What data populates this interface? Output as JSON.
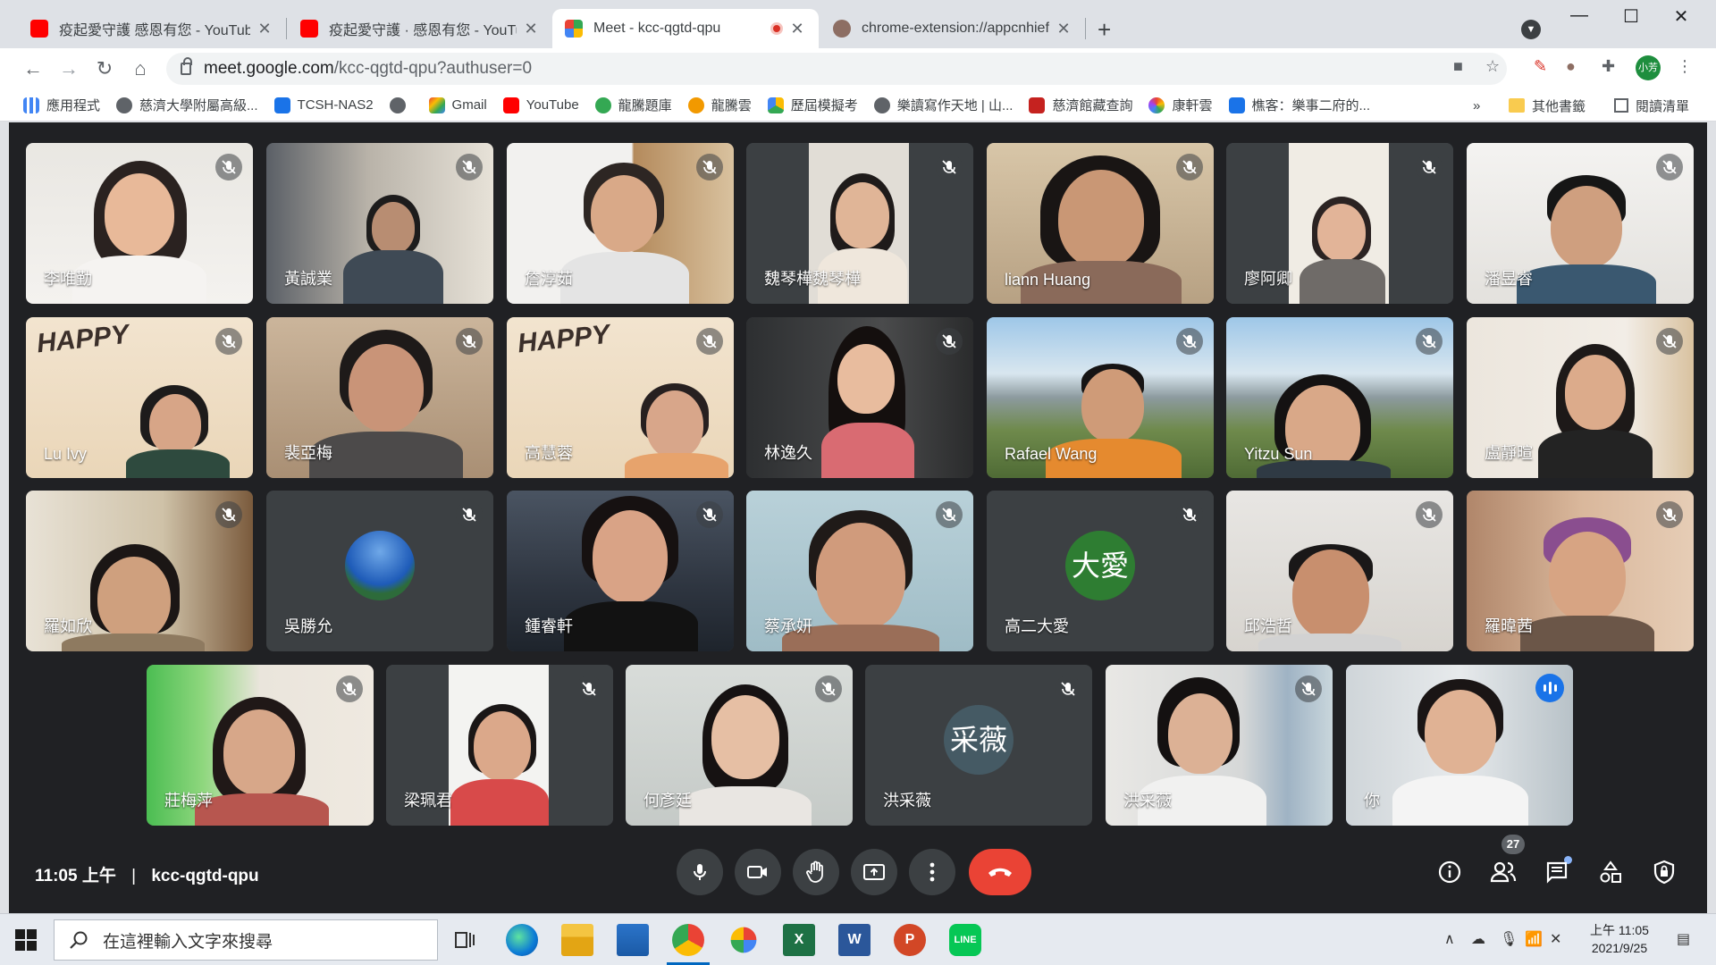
{
  "browser": {
    "tabs": [
      {
        "title": "疫起愛守護 感恩有您 - YouTube",
        "icon": "youtube-icon"
      },
      {
        "title": "疫起愛守護 · 感恩有您 - YouTube",
        "icon": "youtube-icon"
      },
      {
        "title": "Meet - kcc-qgtd-qpu",
        "icon": "google-meet-icon"
      },
      {
        "title": "chrome-extension://appcnhiefc",
        "icon": "extension-icon"
      }
    ],
    "url_host": "meet.google.com",
    "url_path": "/kcc-qgtd-qpu?authuser=0",
    "profile_initials": "小芳",
    "bookmarks": [
      {
        "label": "應用程式"
      },
      {
        "label": "慈濟大學附屬高級..."
      },
      {
        "label": "TCSH-NAS2"
      },
      {
        "label": ""
      },
      {
        "label": "Gmail"
      },
      {
        "label": "YouTube"
      },
      {
        "label": "龍騰題庫"
      },
      {
        "label": "龍騰雲"
      },
      {
        "label": "歷屆模擬考"
      },
      {
        "label": "樂讀寫作天地 | 山..."
      },
      {
        "label": "慈濟館藏查詢"
      },
      {
        "label": "康軒雲"
      },
      {
        "label": "樵客：樂事二府的..."
      }
    ],
    "more_bookmarks": "»",
    "other_bookmarks": "其他書籤",
    "reading_list": "閱讀清單"
  },
  "meeting": {
    "time": "11:05 上午",
    "code": "kcc-qgtd-qpu",
    "participant_count": "27",
    "participants": [
      {
        "name": "李唯勤"
      },
      {
        "name": "黃誠業"
      },
      {
        "name": "詹淳茹"
      },
      {
        "name": "魏琴樺魏琴樺"
      },
      {
        "name": "liann Huang"
      },
      {
        "name": "廖阿卿"
      },
      {
        "name": "潘昱睿"
      },
      {
        "name": "Lu Ivy"
      },
      {
        "name": "裴亞梅"
      },
      {
        "name": "高慧蓉"
      },
      {
        "name": "林逸久"
      },
      {
        "name": "Rafael Wang"
      },
      {
        "name": "Yitzu Sun"
      },
      {
        "name": "盧靜暄"
      },
      {
        "name": "羅如欣"
      },
      {
        "name": "吳勝允"
      },
      {
        "name": "鍾睿軒"
      },
      {
        "name": "蔡承妍"
      },
      {
        "name": "高二大愛",
        "initials": "大愛"
      },
      {
        "name": "邱浩哲"
      },
      {
        "name": "羅暐茜"
      },
      {
        "name": "莊梅萍"
      },
      {
        "name": "梁珮君"
      },
      {
        "name": "何彥廷"
      },
      {
        "name": "洪采薇",
        "initials": "采薇"
      },
      {
        "name": "洪采薇"
      },
      {
        "name": "你"
      }
    ]
  },
  "taskbar": {
    "search_placeholder": "在這裡輸入文字來搜尋",
    "clock_time": "上午 11:05",
    "clock_date": "2021/9/25"
  },
  "colors": {
    "meet_bg": "#202124",
    "tile_bg": "#3c4043",
    "end_call": "#ea4335",
    "speaking": "#1a73e8"
  }
}
